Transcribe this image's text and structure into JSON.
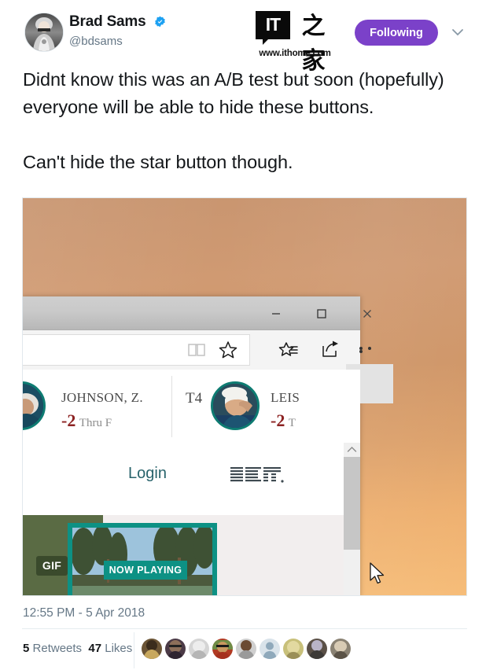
{
  "tweet": {
    "author": {
      "display_name": "Brad Sams",
      "handle": "@bdsams",
      "verified_badge": "verified-check-icon",
      "avatar": "user-avatar"
    },
    "watermark": {
      "logo_text": "IT",
      "logo_cn": "之家",
      "url": "www.ithome.com"
    },
    "follow_button_label": "Following",
    "caret_icon": "chevron-down-icon",
    "text": "Didnt know this was an A/B test but soon (hopefully) everyone will be able to hide these buttons.\n\nCan't hide the star button though.",
    "timestamp": "12:55 PM - 5 Apr 2018",
    "stats": {
      "retweets_count": "5",
      "retweets_label": "Retweets",
      "likes_count": "47",
      "likes_label": "Likes"
    },
    "liker_avatars": [
      "liker-1",
      "liker-2",
      "liker-3",
      "liker-4",
      "liker-5",
      "liker-6",
      "liker-7",
      "liker-8",
      "liker-9"
    ]
  },
  "media": {
    "alt": "screenshot of Microsoft Edge browser on tan desktop wallpaper",
    "window_controls": {
      "minimize": "minimize-icon",
      "maximize": "maximize-icon",
      "close": "close-icon"
    },
    "toolbar_icons": {
      "reading_view": "book-reading-view-icon",
      "favorite": "star-icon",
      "hub": "favorites-hub-icon",
      "share": "share-icon",
      "more": "more-ellipsis-icon"
    },
    "leaderboard": [
      {
        "position": "",
        "player": "JOHNSON, Z.",
        "score": "-2",
        "thru": "Thru F"
      },
      {
        "position": "T4",
        "player": "LEIS",
        "score": "-2",
        "thru": "T"
      }
    ],
    "page": {
      "login_label": "Login",
      "sponsor_logo": "IBM",
      "gif_badge": "GIF",
      "now_playing_label": "NOW PLAYING"
    },
    "scrollbar": {
      "up_arrow": "chevron-up-icon"
    },
    "cursor": "mouse-pointer-icon"
  },
  "colors": {
    "follow_purple": "#7b41c9",
    "verified_blue": "#1da1f2",
    "link_teal": "#28636b",
    "score_red": "#8c2222",
    "ring_teal": "#0e7c72",
    "wallpaper_top": "#c89570",
    "wallpaper_bottom": "#f6bd79"
  }
}
